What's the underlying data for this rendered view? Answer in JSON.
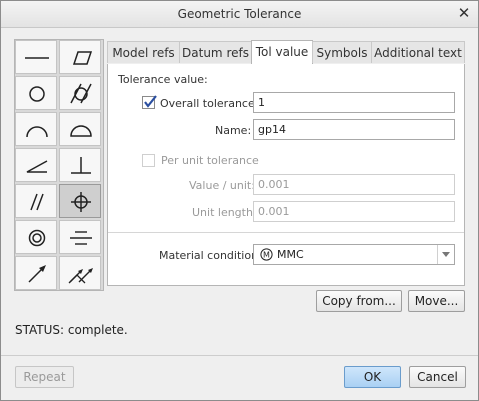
{
  "window": {
    "title": "Geometric Tolerance"
  },
  "palette": {
    "symbols": [
      {
        "name": "straightness-icon"
      },
      {
        "name": "flatness-icon"
      },
      {
        "name": "circularity-icon"
      },
      {
        "name": "cylindricity-icon"
      },
      {
        "name": "line-profile-icon"
      },
      {
        "name": "surface-profile-icon"
      },
      {
        "name": "angularity-icon"
      },
      {
        "name": "perpendicularity-icon"
      },
      {
        "name": "parallelism-icon"
      },
      {
        "name": "position-icon"
      },
      {
        "name": "concentricity-icon"
      },
      {
        "name": "symmetry-icon"
      },
      {
        "name": "circular-runout-icon"
      },
      {
        "name": "total-runout-icon"
      }
    ],
    "selected": "position-icon"
  },
  "tabs": [
    {
      "label": "Model refs"
    },
    {
      "label": "Datum refs"
    },
    {
      "label": "Tol value",
      "active": true
    },
    {
      "label": "Symbols"
    },
    {
      "label": "Additional text"
    }
  ],
  "panel": {
    "section_label": "Tolerance value:",
    "overall_label": "Overall tolerance:",
    "overall_checked": true,
    "overall_value": "1",
    "name_label": "Name:",
    "name_value": "gp14",
    "per_unit_label": "Per unit tolerance",
    "per_unit_checked": false,
    "value_unit_label": "Value / unit:",
    "value_unit_value": "0.001",
    "unit_length_label": "Unit length:",
    "unit_length_value": "0.001",
    "material_label": "Material condition:",
    "material_value": "MMC",
    "material_icon": "mmc-circle-m-icon"
  },
  "buttons": {
    "copy_from": "Copy from...",
    "move": "Move...",
    "repeat": "Repeat",
    "ok": "OK",
    "cancel": "Cancel"
  },
  "status": "STATUS: complete.",
  "colors": {
    "ok_button": "#b9dbf6",
    "check_mark": "#2b4fa0"
  }
}
